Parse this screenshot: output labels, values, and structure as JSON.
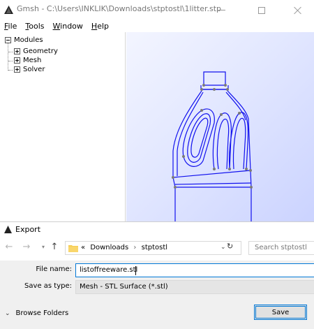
{
  "gmsh": {
    "title": "Gmsh - C:\\Users\\INKLIK\\Downloads\\stptostl\\1litter.stp",
    "menu": [
      {
        "mnemonic": "F",
        "rest": "ile"
      },
      {
        "mnemonic": "T",
        "rest": "ools"
      },
      {
        "mnemonic": "W",
        "rest": "indow"
      },
      {
        "mnemonic": "H",
        "rest": "elp"
      }
    ],
    "tree": {
      "root": "Modules",
      "children": [
        "Geometry",
        "Mesh",
        "Solver"
      ]
    },
    "colors": {
      "model_wire": "#1010ee",
      "model_points": "#7a7a7a",
      "viewport_bg": "#dfe4ff"
    }
  },
  "export_dialog": {
    "title": "Export",
    "breadcrumb": {
      "prefix": "«",
      "items": [
        "Downloads",
        "stptostl"
      ]
    },
    "search_placeholder": "Search stptostl",
    "file_name_label": "File name:",
    "file_name_value": "listoffreeware.stl",
    "save_type_label": "Save as type:",
    "save_type_value": "Mesh - STL Surface (*.stl)",
    "browse_folders_label": "Browse Folders",
    "save_label": "Save",
    "accent_color": "#0078d7"
  }
}
